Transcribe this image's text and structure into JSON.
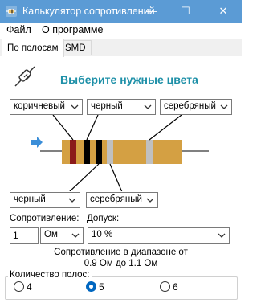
{
  "window": {
    "title": "Калькулятор сопротивлений",
    "icon": "resistor-app-icon",
    "controls": {
      "minimize": "—",
      "maximize": "☐",
      "close": "✕"
    }
  },
  "menu": {
    "items": [
      {
        "label": "Файл"
      },
      {
        "label": "О программе"
      }
    ]
  },
  "tabs": [
    {
      "label": "По полосам",
      "active": true
    },
    {
      "label": "SMD",
      "active": false
    }
  ],
  "main": {
    "heading": "Выберите нужные цвета",
    "heading_color": "#1e90a8",
    "top_selectors": [
      {
        "value": "коричневый"
      },
      {
        "value": "черный"
      },
      {
        "value": "серебряный"
      }
    ],
    "bottom_selectors": [
      {
        "value": "черный"
      },
      {
        "value": "серебряный"
      }
    ],
    "resistor": {
      "body_color": "#d4a043",
      "bands": [
        "#8b1a1a",
        "#000000",
        "#000000",
        "#c0c0c0",
        "#c0c0c0"
      ]
    }
  },
  "form": {
    "resistance_label": "Сопротивление:",
    "resistance_value": "1",
    "resistance_unit": "Ом",
    "tolerance_label": "Допуск:",
    "tolerance_value": "10 %",
    "range_line1": "Сопротивление в диапазоне от",
    "range_line2": "0.9 Ом до 1.1 Ом"
  },
  "band_count": {
    "title": "Количество полос:",
    "options": [
      {
        "label": "4",
        "checked": false
      },
      {
        "label": "5",
        "checked": true
      },
      {
        "label": "6",
        "checked": false
      }
    ]
  },
  "colors": {
    "titlebar": "#5b9bd5",
    "accent": "#0067c0"
  }
}
